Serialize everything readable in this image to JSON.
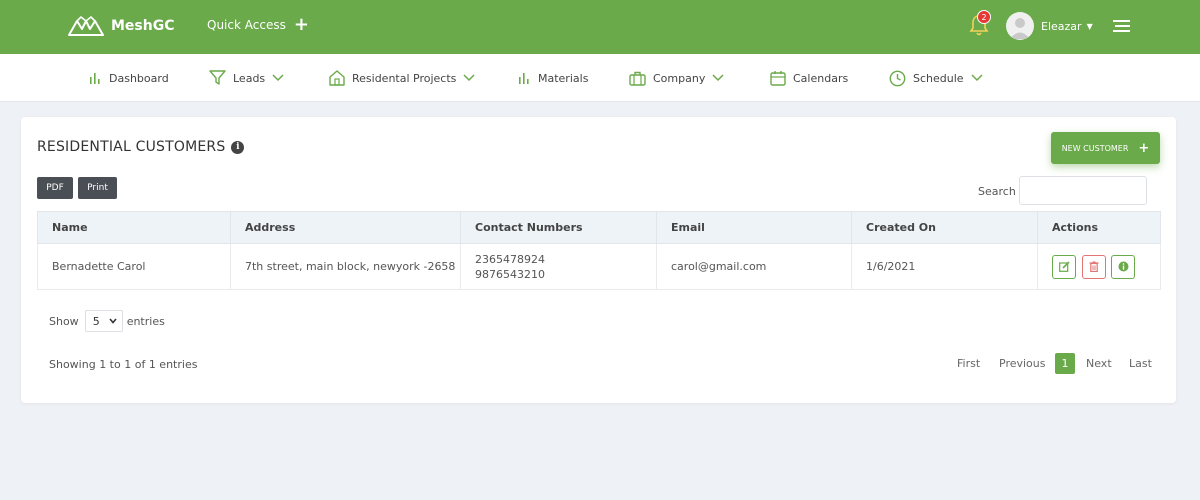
{
  "header": {
    "app_name": "MeshGC",
    "quick_access": "Quick Access",
    "notification_count": "2",
    "user_name": "Eleazar"
  },
  "nav": {
    "items": [
      {
        "label": "Dashboard",
        "icon": "bar-chart-icon",
        "dropdown": false
      },
      {
        "label": "Leads",
        "icon": "filter-icon",
        "dropdown": true
      },
      {
        "label": "Residental Projects",
        "icon": "home-icon",
        "dropdown": true
      },
      {
        "label": "Materials",
        "icon": "bar-chart-icon",
        "dropdown": false
      },
      {
        "label": "Company",
        "icon": "briefcase-icon",
        "dropdown": true
      },
      {
        "label": "Calendars",
        "icon": "calendar-icon",
        "dropdown": false
      },
      {
        "label": "Schedule",
        "icon": "clock-icon",
        "dropdown": true
      }
    ]
  },
  "page": {
    "title": "RESIDENTIAL CUSTOMERS",
    "new_customer": "NEW CUSTOMER",
    "pdf": "PDF",
    "print": "Print",
    "search_label": "Search",
    "search_value": ""
  },
  "table": {
    "headers": [
      "Name",
      "Address",
      "Contact Numbers",
      "Email",
      "Created On",
      "Actions"
    ],
    "rows": [
      {
        "name": "Bernadette Carol",
        "address": "7th street, main block, newyork -2658",
        "phone1": "2365478924",
        "phone2": "9876543210",
        "email": "carol@gmail.com",
        "created": "1/6/2021"
      }
    ]
  },
  "footer": {
    "show": "Show",
    "entries_value": "5",
    "entries": "entries",
    "showing": "Showing 1 to 1 of 1 entries",
    "first": "First",
    "previous": "Previous",
    "page": "1",
    "next": "Next",
    "last": "Last"
  },
  "colors": {
    "brand": "#6aaa4a",
    "danger": "#e57373",
    "dark_button": "#4a4f55",
    "background": "#eef1f5"
  }
}
